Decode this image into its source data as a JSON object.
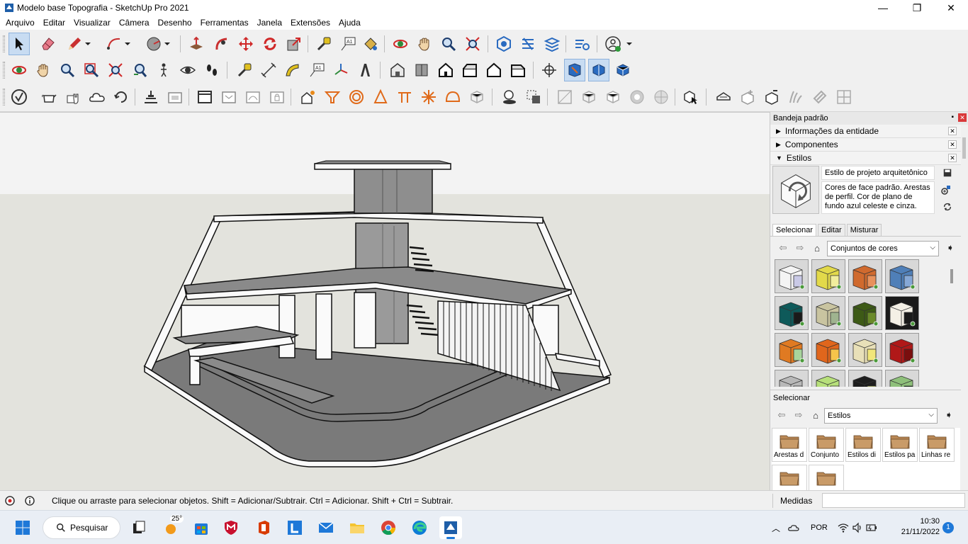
{
  "window": {
    "title": "Modelo base Topografia - SketchUp Pro 2021",
    "minimize_glyph": "—",
    "restore_glyph": "❐",
    "close_glyph": "✕"
  },
  "menu": [
    "Arquivo",
    "Editar",
    "Visualizar",
    "Câmera",
    "Desenho",
    "Ferramentas",
    "Janela",
    "Extensões",
    "Ajuda"
  ],
  "tray": {
    "title": "Bandeja padrão",
    "panels": [
      {
        "label": "Informações da entidade",
        "expanded": false
      },
      {
        "label": "Componentes",
        "expanded": false
      },
      {
        "label": "Estilos",
        "expanded": true
      }
    ],
    "styles": {
      "style_name": "Estilo de projeto arquitetônico",
      "style_description": "Cores de face padrão. Arestas de perfil. Cor de plano de fundo azul celeste e cinza.",
      "tabs": [
        "Selecionar",
        "Editar",
        "Misturar"
      ],
      "selected_tab": "Selecionar",
      "collection": "Conjuntos de cores",
      "secondary_label": "Selecionar",
      "secondary_collection": "Estilos",
      "swatch_colors": [
        [
          "#f4f4f4",
          "#c9c9e6"
        ],
        [
          "#e2d94a",
          "#f1ee9c"
        ],
        [
          "#d06a2e",
          "#e8925c"
        ],
        [
          "#4f7fb8",
          "#86a8d6"
        ],
        [
          "#0e5a5a",
          "#1a1a1a"
        ],
        [
          "#c9c4a0",
          "#9fb38f"
        ],
        [
          "#3d5a16",
          "#6a8a2a"
        ],
        [
          "#f4f0e6",
          "#1a1a1a"
        ],
        [
          "#e07a22",
          "#a8d49c"
        ],
        [
          "#e0661c",
          "#f6c44a"
        ],
        [
          "#e8e0b8",
          "#f1e67a"
        ],
        [
          "#b01818",
          "#7a0e0e"
        ],
        [
          "#b8b8b8",
          "#e0e0e0"
        ],
        [
          "#b7e07a",
          "#e6f4c4"
        ],
        [
          "#1e1e1e",
          "#d7e07a"
        ],
        [
          "#8ec07a",
          "#1e3a1e"
        ]
      ],
      "folders": [
        "Arestas d",
        "Conjunto",
        "Estilos di",
        "Estilos pa",
        "Linhas re",
        "",
        ""
      ]
    }
  },
  "status": {
    "message": "Clique ou arraste para selecionar objetos. Shift = Adicionar/Subtrair. Ctrl = Adicionar. Shift + Ctrl = Subtrair.",
    "measures_label": "Medidas",
    "measures_value": ""
  },
  "taskbar": {
    "search_label": "Pesquisar",
    "weather_temp": "25°",
    "language": "POR",
    "time": "10:30",
    "date": "21/11/2022",
    "notification_count": "1"
  },
  "colors": {
    "sky": "#f1f1f1",
    "ground": "#e2e2dc",
    "accent": "#1e78d8",
    "close_red": "#d9383a"
  }
}
